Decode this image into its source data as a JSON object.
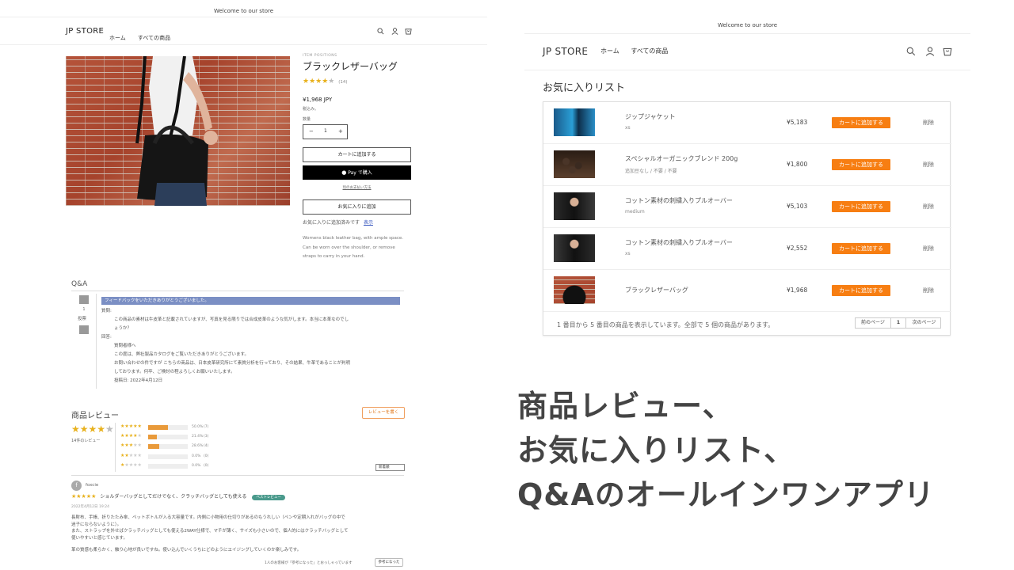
{
  "left": {
    "announcement": "Welcome to our store",
    "logo": "JP STORE",
    "nav": [
      "ホーム",
      "すべての商品"
    ],
    "product": {
      "vendor": "ITEM POSITIONS",
      "title": "ブラックレザーバッグ",
      "rating_count": "(14)",
      "price": "¥1,968 JPY",
      "tax_note": "税込み。",
      "qty_label": "数量",
      "qty_value": "1",
      "minus": "−",
      "plus": "+",
      "add_to_cart": "カートに追加する",
      "apple_pay": " Pay で購入",
      "more_pay": "別のお支払い方法",
      "add_favorite": "お気に入りに追加",
      "fav_added": "お気に入りに追加済みです",
      "fav_view": "表示",
      "description": [
        "Womens black leather bag, with ample space.",
        "Can be worn over the shoulder, or remove",
        "straps to carry in your hand."
      ]
    },
    "qa": {
      "title": "Q&A",
      "vote_count": "1",
      "vote_label": "投票",
      "feedback_banner": "フィードバックをいただきありがとうございました。",
      "question_label": "質問:",
      "question_lines": [
        "この商品の素材は牛皮革と記載されていますが、写真を見る限りでは合成皮革のような気がします。本当に本革なのでし",
        "ょうか？"
      ],
      "answer_label": "回答:",
      "answer_lines": [
        "質問者様へ",
        "この度は、弊社製品カタログをご覧いただきありがとうございます。",
        "お問い合わせの件ですが こちらの商品は、日本皮革研究所にて素質分析を行っており、その結果、牛革であることが判明",
        "しております。何卒、ご検討の程よろしくお願いいたします。",
        "投稿日: 2022年4月12日"
      ]
    },
    "reviews": {
      "title": "商品レビュー",
      "write_button": "レビューを書く",
      "count_label": "14件のレビュー",
      "distribution": [
        {
          "stars": 5,
          "pct_text": "50.0%",
          "count": "(7)",
          "fraction": 0.5
        },
        {
          "stars": 4,
          "pct_text": "21.4%",
          "count": "(3)",
          "fraction": 0.214
        },
        {
          "stars": 3,
          "pct_text": "28.6%",
          "count": "(4)",
          "fraction": 0.286
        },
        {
          "stars": 2,
          "pct_text": "0.0%",
          "count": "(0)",
          "fraction": 0
        },
        {
          "stars": 1,
          "pct_text": "0.0%",
          "count": "(0)",
          "fraction": 0
        }
      ],
      "sort_label": "新着順",
      "review": {
        "avatar_letter": "f",
        "author": "foxcie",
        "headline": "ショルダーバッグとしてだけでなく、クラッチバッグとしても使える",
        "badge": "ベストレビュー",
        "date": "2022年4月12日 19:24",
        "body": [
          "長財布、手帳、折りたたみ傘、ペットボトルが入る大容量です。内側に小物用の仕切りがあるのもうれしい（ペンや定期入れがバッグの中で",
          "迷子にならないように）。",
          "また、ストラップを外せばクラッチバッグとしても使える2WAY仕様で、マチが薄く、サイズも小さいので、個人的にはクラッチバッグとして",
          "使いやすいと感じています。",
          "",
          "革の質感も柔らかく、触り心地が良いですね。使い込んでいくうちにどのようにエイジングしていくのか楽しみです。"
        ],
        "helpful_text": "1人のお客様が「参考になった」とおっしゃっています",
        "helpful_button": "参考になった"
      }
    }
  },
  "right": {
    "announcement": "Welcome to our store",
    "logo": "JP STORE",
    "nav": [
      "ホーム",
      "すべての商品"
    ],
    "title": "お気に入りリスト",
    "items": [
      {
        "name": "ジップジャケット",
        "variant": "xs",
        "price": "¥5,183",
        "button": "カートに追加する",
        "remove": "削除"
      },
      {
        "name": "スペシャルオーガニックブレンド 200g",
        "variant": "追加豆なし / 不要 / 不要",
        "price": "¥1,800",
        "button": "カートに追加する",
        "remove": "削除"
      },
      {
        "name": "コットン素材の刺繍入りプルオーバー",
        "variant": "medium",
        "price": "¥5,103",
        "button": "カートに追加する",
        "remove": "削除"
      },
      {
        "name": "コットン素材の刺繍入りプルオーバー",
        "variant": "xs",
        "price": "¥2,552",
        "button": "カートに追加する",
        "remove": "削除"
      },
      {
        "name": "ブラックレザーバッグ",
        "variant": "",
        "price": "¥1,968",
        "button": "カートに追加する",
        "remove": "削除"
      }
    ],
    "footer_text": "1 番目から 5 番目の商品を表示しています。全部で 5 個の商品があります。",
    "prev_page": "前のページ",
    "page": "1",
    "next_page": "次のページ"
  },
  "headline": [
    "商品レビュー、",
    "お気に入りリスト、",
    "Q&Aのオールインワンアプリ"
  ],
  "colors": {
    "accent": "#f77e12",
    "star": "#e8b11c",
    "bar": "#e99a3a",
    "banner": "#7b8fc4",
    "badge": "#4a9a8c"
  }
}
